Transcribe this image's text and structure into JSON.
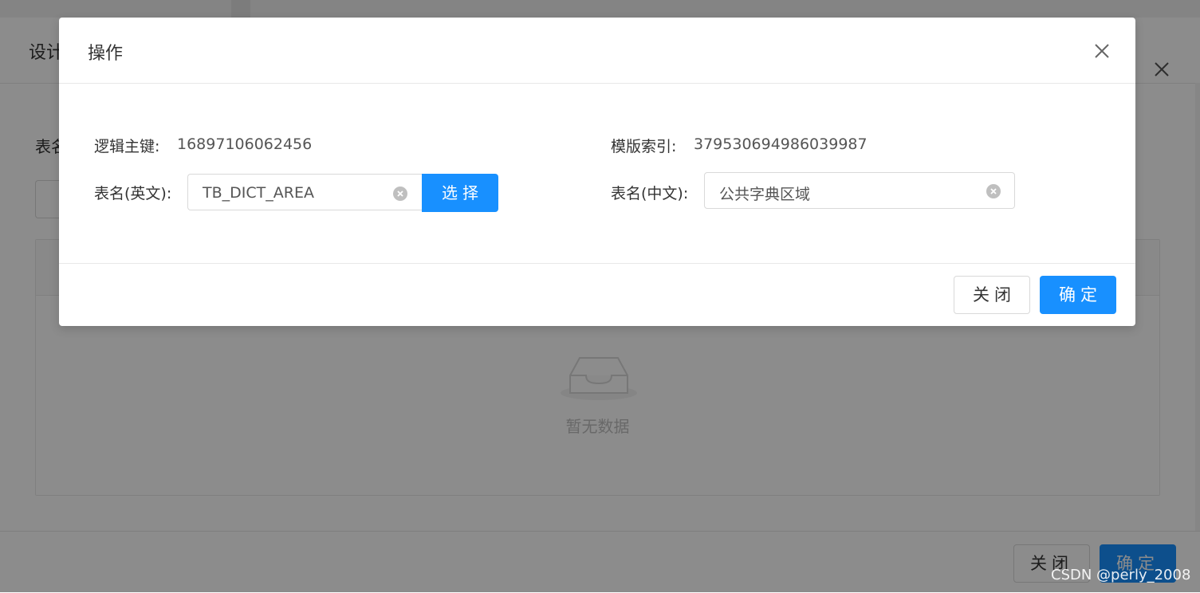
{
  "background": {
    "title": "设计",
    "field_label": "表名",
    "empty_text": "暂无数据",
    "close_label": "关闭",
    "ok_label": "确定"
  },
  "modal": {
    "title": "操作",
    "fields": {
      "logic_key_label": "逻辑主键:",
      "logic_key_value": "16897106062456",
      "template_index_label": "模版索引:",
      "template_index_value": "379530694986039987",
      "table_name_en_label": "表名(英文):",
      "table_name_en_value": "TB_DICT_AREA",
      "table_name_cn_label": "表名(中文):",
      "table_name_cn_value": "公共字典区域"
    },
    "select_label": "选择",
    "close_label": "关闭",
    "ok_label": "确定"
  },
  "watermark": "CSDN @perly_2008",
  "colors": {
    "primary": "#1890ff",
    "mask": "rgba(0,0,0,0.45)"
  }
}
